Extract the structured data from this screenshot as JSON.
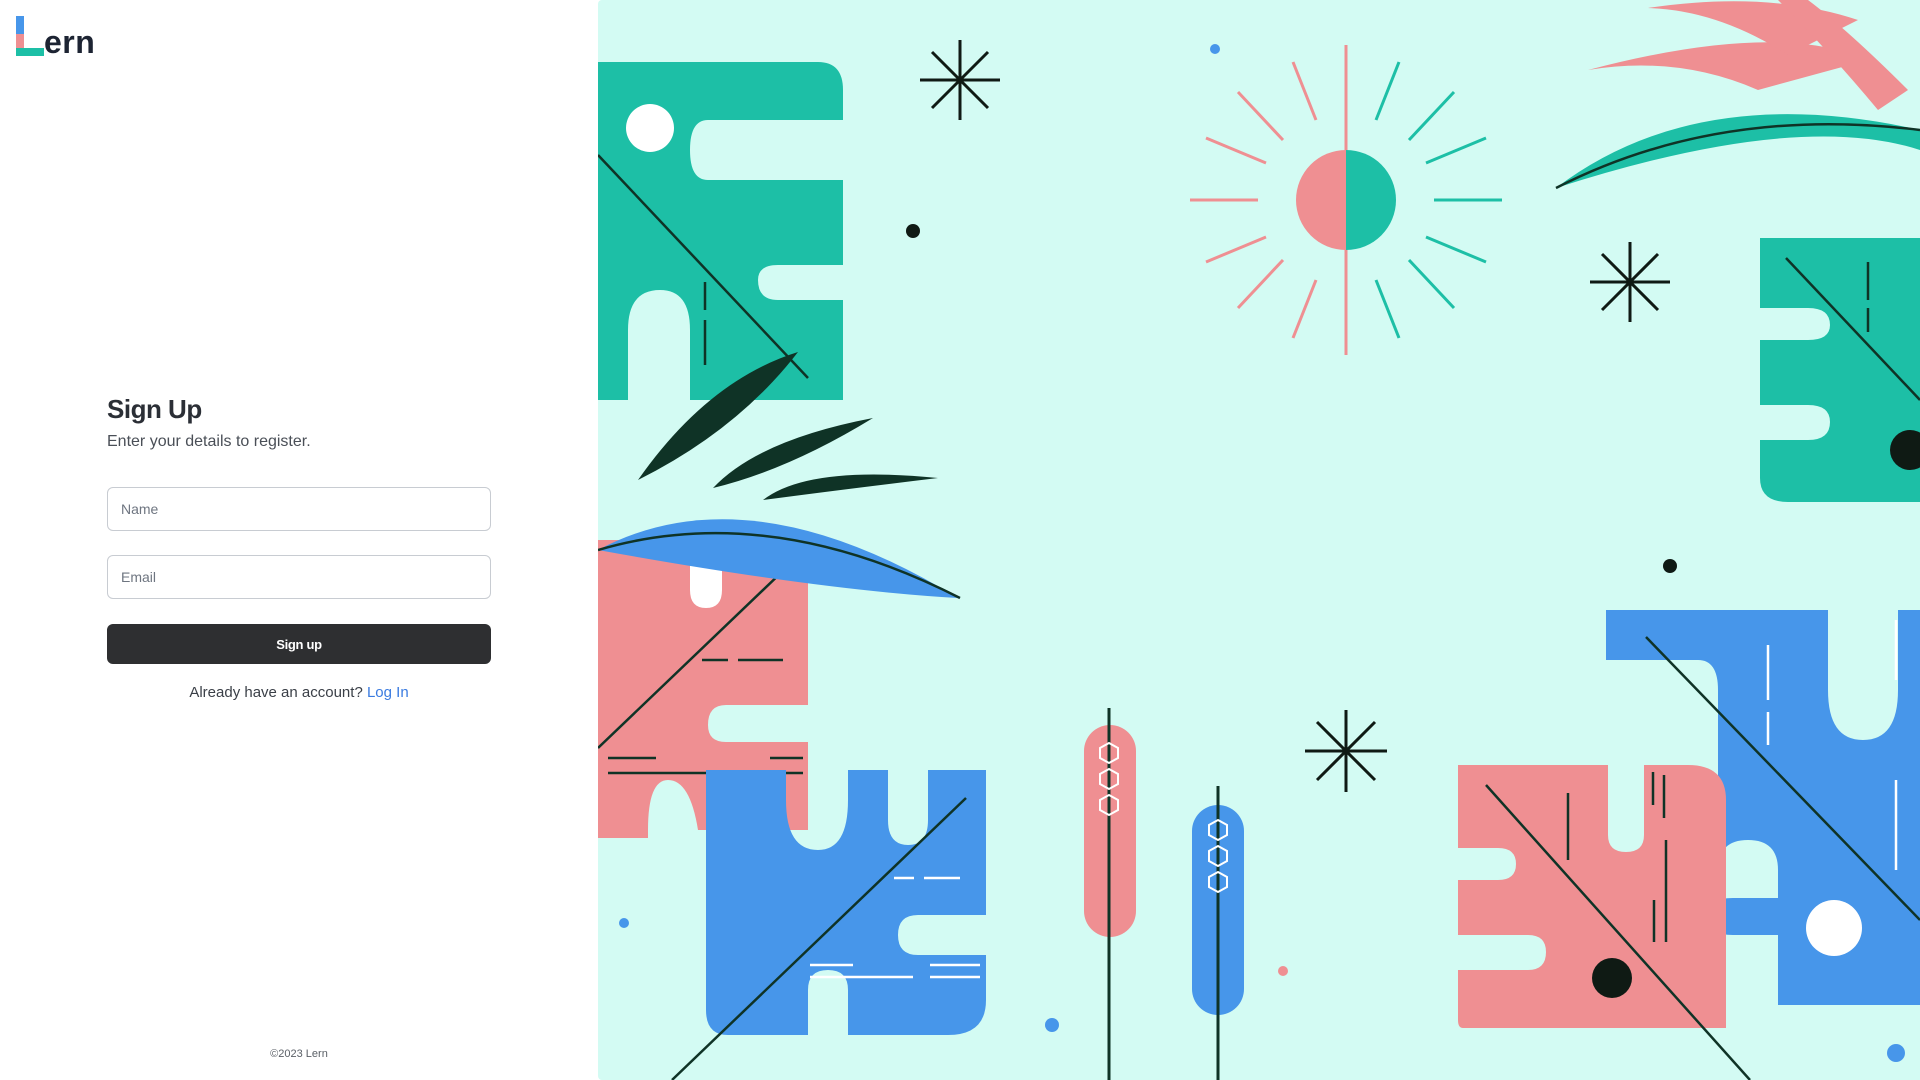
{
  "brand": {
    "name": "ern"
  },
  "form": {
    "title": "Sign Up",
    "subtitle": "Enter your details to register.",
    "name_placeholder": "Name",
    "email_placeholder": "Email",
    "submit_label": "Sign up",
    "login_prompt": "Already have an account?",
    "login_link": "Log In"
  },
  "footer": {
    "copyright": "©2023 Lern"
  },
  "colors": {
    "teal": "#1dbfa6",
    "coral": "#ef8f92",
    "blue": "#4796ea",
    "mint_background": "#d3fbf3",
    "dark_green": "#0f3326",
    "button": "#2e2f31",
    "link": "#3a7be0"
  }
}
